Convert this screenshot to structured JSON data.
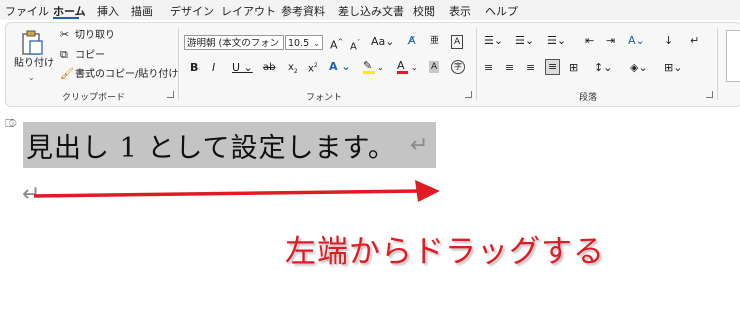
{
  "menu": [
    "ファイル",
    "ホーム",
    "挿入",
    "描画",
    "デザイン",
    "レイアウト",
    "参考資料",
    "差し込み文書",
    "校閲",
    "表示",
    "ヘルプ"
  ],
  "clipboard": {
    "paste": "貼り付け",
    "cut": "切り取り",
    "copy": "コピー",
    "format_painter": "書式のコピー/貼り付け",
    "label": "クリップボード"
  },
  "font": {
    "name": "游明朝 (本文のフォン",
    "size": "10.5",
    "label": "フォント"
  },
  "paragraph": {
    "label": "段落"
  },
  "document": {
    "heading": "見出し 1 として設定します。"
  },
  "annotation": "左端からドラッグする",
  "colors": {
    "accent": "#1a5fb4",
    "annotation_red": "#e01b24",
    "selection": "#c4c4c4",
    "highlight_yellow": "#ffeb00",
    "font_red": "#e01b24"
  }
}
